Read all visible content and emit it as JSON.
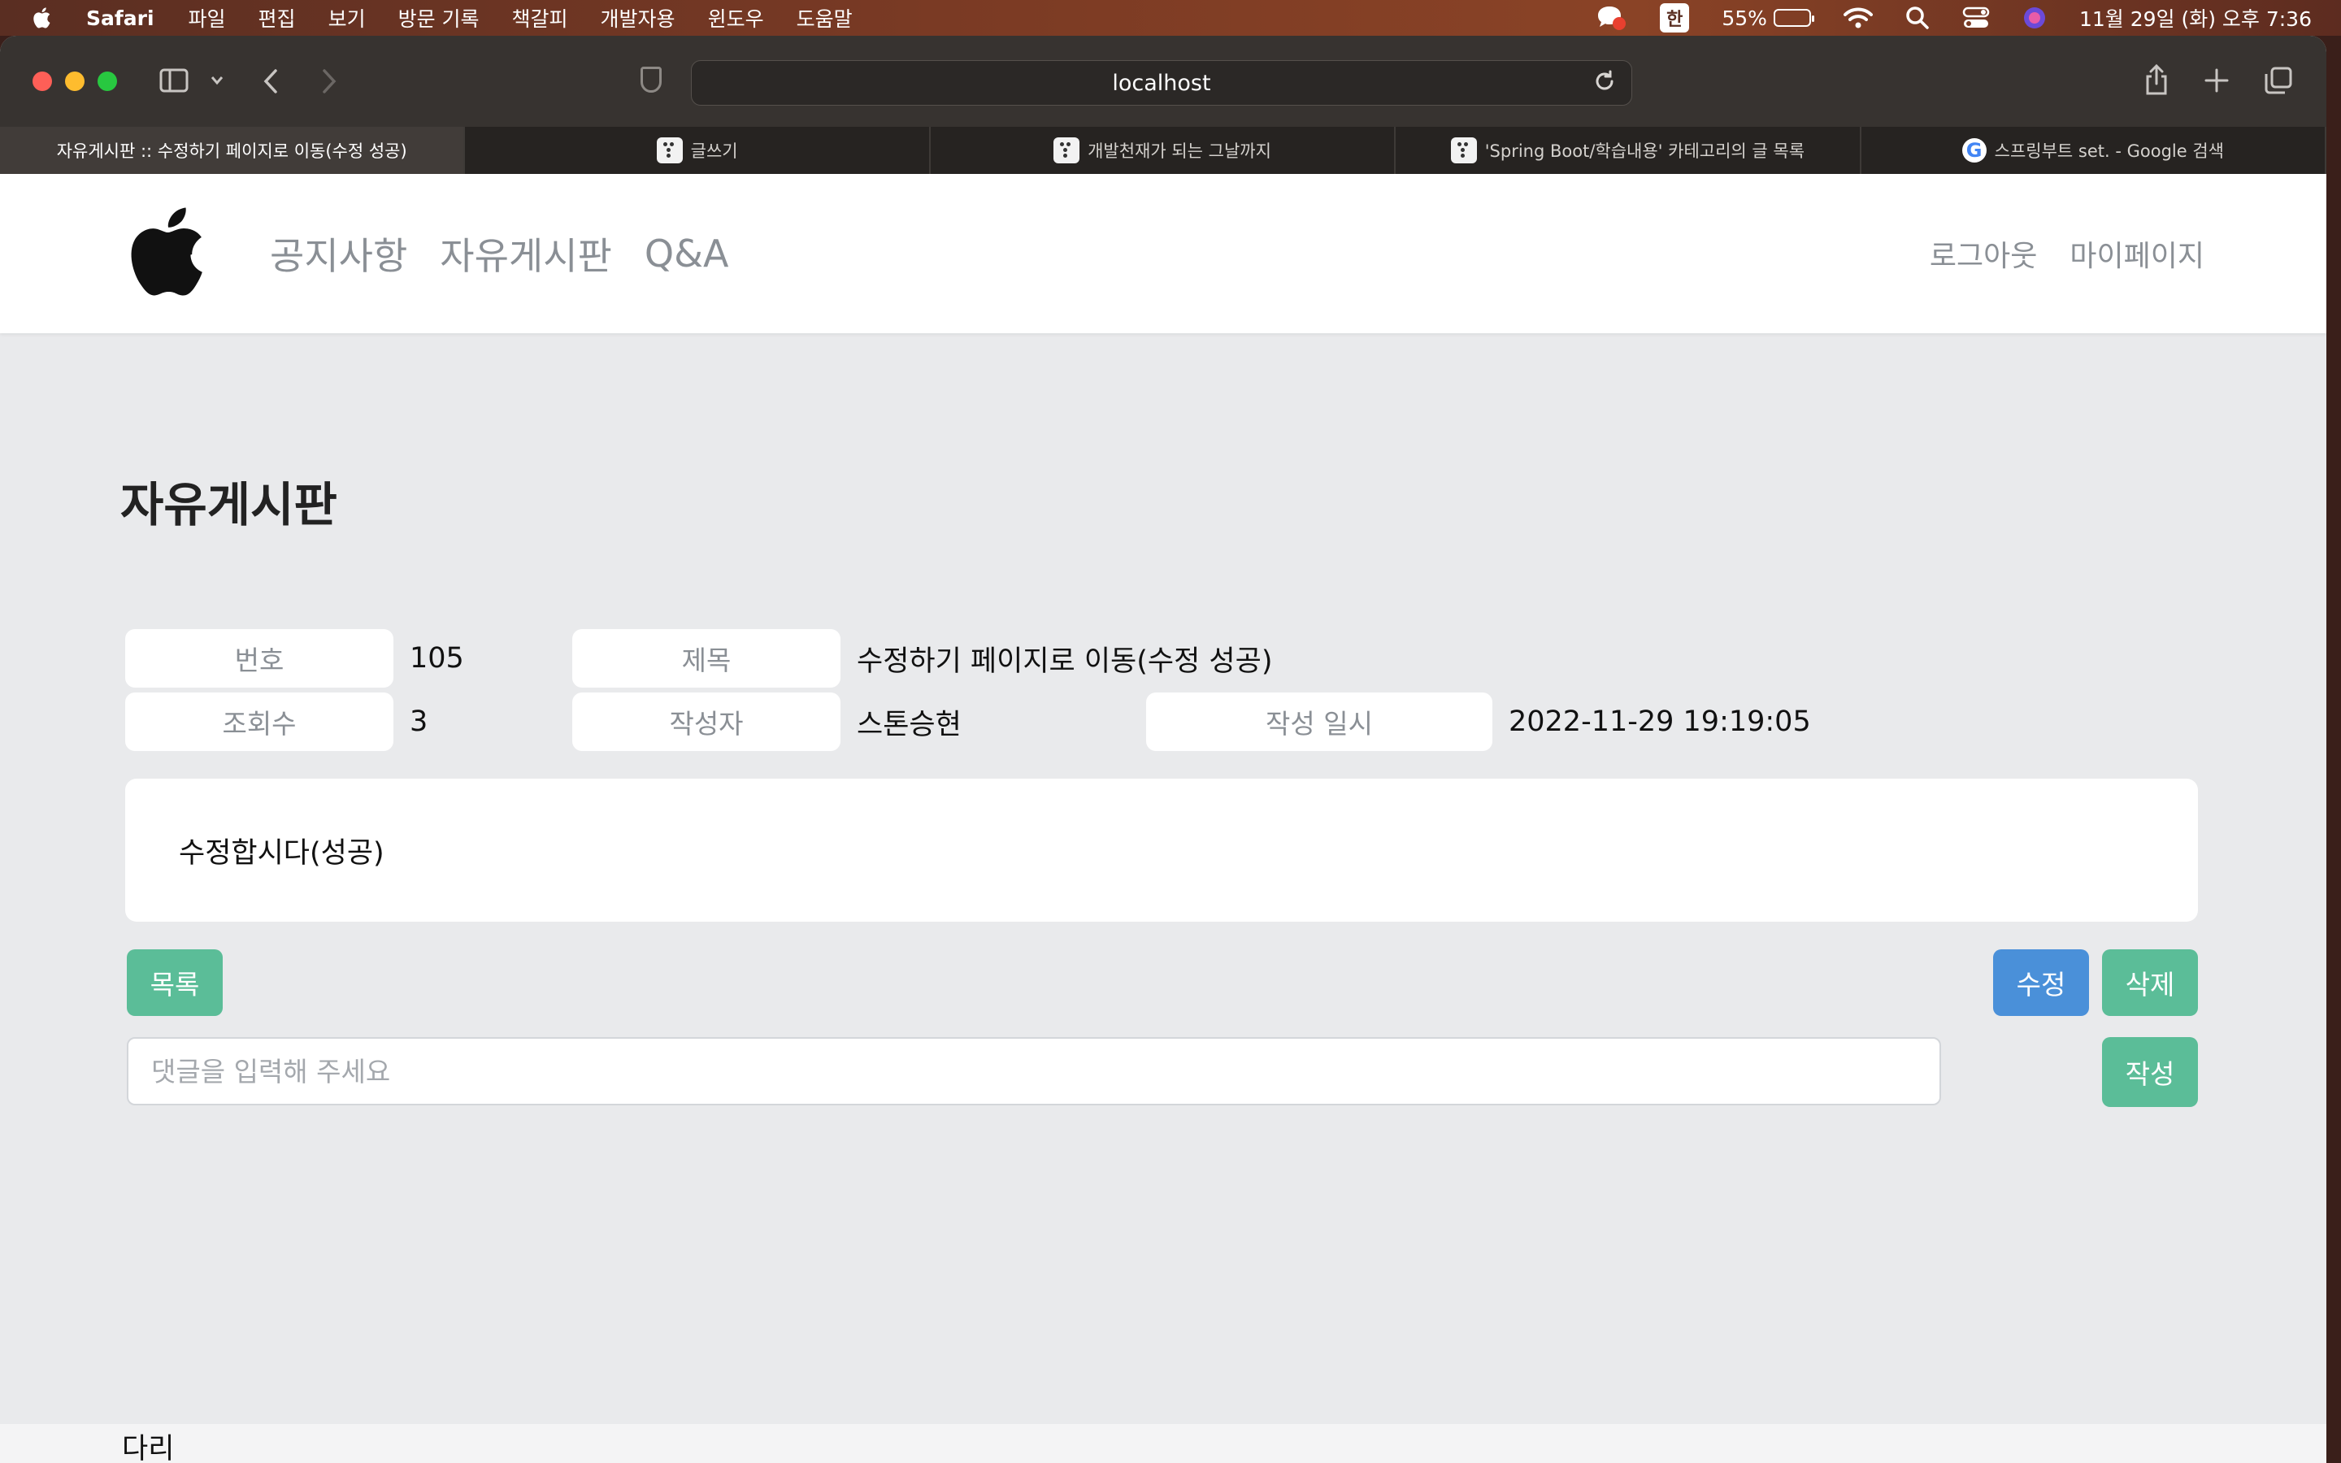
{
  "menubar": {
    "app_name": "Safari",
    "items": [
      "파일",
      "편집",
      "보기",
      "방문 기록",
      "책갈피",
      "개발자용",
      "윈도우",
      "도움말"
    ],
    "ime": "한",
    "battery_percent": "55%",
    "battery_level": 0.55,
    "datetime": "11월 29일 (화) 오후 7:36"
  },
  "browser": {
    "address": "localhost",
    "tabs": [
      {
        "title": "자유게시판 :: 수정하기 페이지로 이동(수정 성공)",
        "favicon": "none",
        "active": true
      },
      {
        "title": "글쓰기",
        "favicon": "tistory-icon",
        "active": false
      },
      {
        "title": "개발천재가 되는 그날까지",
        "favicon": "tistory-icon",
        "active": false
      },
      {
        "title": "'Spring Boot/학습내용' 카테고리의 글 목록",
        "favicon": "tistory-icon",
        "active": false
      },
      {
        "title": "스프링부트 set. - Google 검색",
        "favicon": "google-icon",
        "active": false
      }
    ]
  },
  "navbar": {
    "links": [
      "공지사항",
      "자유게시판",
      "Q&A"
    ],
    "right_links": [
      "로그아웃",
      "마이페이지"
    ]
  },
  "board": {
    "title": "자유게시판",
    "fields": {
      "number_label": "번호",
      "number_value": "105",
      "title_label": "제목",
      "title_value": "수정하기 페이지로 이동(수정 성공)",
      "views_label": "조회수",
      "views_value": "3",
      "author_label": "작성자",
      "author_value": "스톤승현",
      "date_label": "작성 일시",
      "date_value": "2022-11-29 19:19:05"
    },
    "content": "수정합시다(성공)",
    "buttons": {
      "list": "목록",
      "edit": "수정",
      "delete": "삭제",
      "write": "작성"
    },
    "comment_placeholder": "댓글을 입력해 주세요"
  },
  "footer": {
    "text": "다리"
  }
}
